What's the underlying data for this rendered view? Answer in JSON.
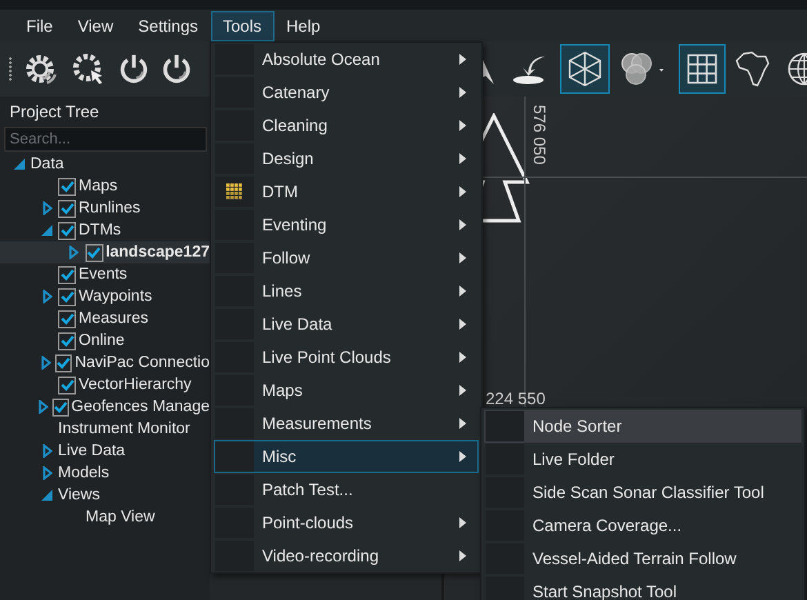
{
  "menubar": [
    {
      "label": "File",
      "selected": false
    },
    {
      "label": "View",
      "selected": false
    },
    {
      "label": "Settings",
      "selected": false
    },
    {
      "label": "Tools",
      "selected": true
    },
    {
      "label": "Help",
      "selected": false
    }
  ],
  "toolbar": {
    "left": [
      {
        "kind": "gear-wave",
        "selected": false
      },
      {
        "kind": "gear-cursor",
        "selected": false
      },
      {
        "kind": "power-wave",
        "selected": false
      },
      {
        "kind": "power-wave",
        "selected": false
      }
    ],
    "right": [
      {
        "kind": "cursor",
        "selected": false
      },
      {
        "kind": "hand",
        "selected": false
      },
      {
        "kind": "cube",
        "selected": true
      },
      {
        "kind": "circles",
        "selected": false
      },
      {
        "kind": "grid",
        "selected": true
      },
      {
        "kind": "africa",
        "selected": false
      },
      {
        "kind": "globe",
        "selected": false
      }
    ]
  },
  "project_tree": {
    "title": "Project Tree",
    "search": {
      "placeholder": "Search..."
    },
    "items": [
      {
        "label": "Data",
        "expanded": true,
        "children": [
          {
            "label": "Maps",
            "checked": true
          },
          {
            "label": "Runlines",
            "checked": true,
            "expanded": false
          },
          {
            "label": "DTMs",
            "checked": true,
            "expanded": true,
            "children": [
              {
                "label": "landscape127",
                "checked": true,
                "selected": true,
                "expanded": false
              }
            ]
          },
          {
            "label": "Events",
            "checked": true
          },
          {
            "label": "Waypoints",
            "checked": true,
            "expanded": false
          },
          {
            "label": "Measures",
            "checked": true
          },
          {
            "label": "Online",
            "checked": true
          },
          {
            "label": "NaviPac Connectio",
            "checked": true,
            "expanded": false
          },
          {
            "label": "VectorHierarchy",
            "checked": true
          },
          {
            "label": "Geofences Manage",
            "checked": true,
            "expanded": false
          },
          {
            "label": "Instrument Monitor"
          },
          {
            "label": "Live Data",
            "expanded": false
          },
          {
            "label": "Models",
            "expanded": false
          },
          {
            "label": "Views",
            "expanded": true,
            "children": [
              {
                "label": "Map View"
              }
            ]
          }
        ]
      }
    ]
  },
  "map": {
    "coord_vertical": "576 050",
    "coord_horizontal": "224 550"
  },
  "tools_menu": [
    {
      "label": "Absolute Ocean",
      "submenu": true,
      "selected": false
    },
    {
      "label": "Catenary",
      "submenu": true,
      "selected": false
    },
    {
      "label": "Cleaning",
      "submenu": true,
      "selected": false
    },
    {
      "label": "Design",
      "submenu": true,
      "selected": false
    },
    {
      "label": "DTM",
      "submenu": true,
      "selected": false
    },
    {
      "label": "Eventing",
      "submenu": true,
      "selected": false
    },
    {
      "label": "Follow",
      "submenu": true,
      "selected": false
    },
    {
      "label": "Lines",
      "submenu": true,
      "selected": false
    },
    {
      "label": "Live Data",
      "submenu": true,
      "selected": false
    },
    {
      "label": "Live Point Clouds",
      "submenu": true,
      "selected": false
    },
    {
      "label": "Maps",
      "submenu": true,
      "selected": false
    },
    {
      "label": "Measurements",
      "submenu": true,
      "selected": false
    },
    {
      "label": "Misc",
      "submenu": true,
      "selected": true
    },
    {
      "label": "Patch Test...",
      "submenu": false,
      "selected": false
    },
    {
      "label": "Point-clouds",
      "submenu": true,
      "selected": false
    },
    {
      "label": "Video-recording",
      "submenu": true,
      "selected": false
    }
  ],
  "misc_submenu": [
    {
      "label": "Node Sorter",
      "selected": true
    },
    {
      "label": "Live Folder",
      "selected": false
    },
    {
      "label": "Side Scan Sonar Classifier Tool",
      "selected": false
    },
    {
      "label": "Camera Coverage...",
      "selected": false
    },
    {
      "label": "Vessel-Aided Terrain Follow",
      "selected": false
    },
    {
      "label": "Start Snapshot Tool",
      "selected": false
    }
  ]
}
